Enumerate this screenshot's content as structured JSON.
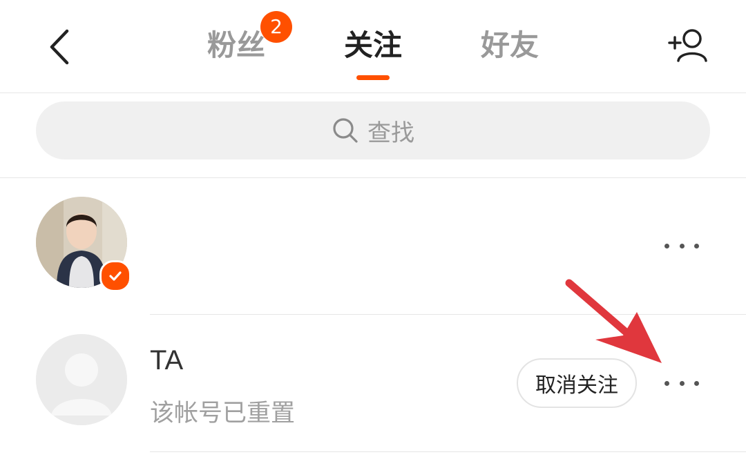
{
  "header": {
    "tabs": [
      {
        "label": "粉丝",
        "badge": "2",
        "active": false
      },
      {
        "label": "关注",
        "active": true
      },
      {
        "label": "好友",
        "active": false
      }
    ],
    "back_icon": "chevron-left-icon",
    "add_user_icon": "add-user-icon"
  },
  "search": {
    "placeholder": "查找",
    "icon": "search-icon"
  },
  "list": [
    {
      "name": "",
      "verified": true,
      "more_icon": "more-dots-icon"
    },
    {
      "name": "TA",
      "subtitle": "该帐号已重置",
      "action_label": "取消关注",
      "more_icon": "more-dots-icon"
    }
  ],
  "colors": {
    "accent": "#ff5000",
    "annotation_arrow": "#e0373d"
  }
}
